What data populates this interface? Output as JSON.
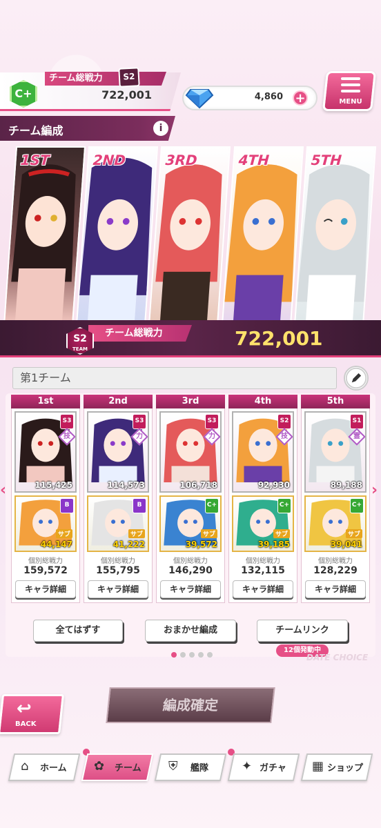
{
  "header": {
    "team_power_label": "チーム総戦力",
    "team_rank_badge": "S2",
    "player_rank": "C+",
    "team_power_value": "722,001",
    "diamonds": "4,860",
    "menu_label": "MENU"
  },
  "section": {
    "title": "チーム編成",
    "info": "i"
  },
  "banner": {
    "places": [
      "1ST",
      "2ND",
      "3RD",
      "4TH",
      "5TH"
    ],
    "power_label": "チーム総戦力",
    "rank_badge": "S2",
    "rank_sub": "TEAM",
    "power_value": "722,001"
  },
  "team_name": "第1チーム",
  "slots": [
    {
      "head": "1st",
      "rank": "S3",
      "type": "技",
      "power": "115,425",
      "sub_rank": "B",
      "sub_tag": "サブ",
      "sub_power": "44,147",
      "indiv_label": "個別総戦力",
      "indiv": "159,572",
      "detail": "キャラ詳細"
    },
    {
      "head": "2nd",
      "rank": "S3",
      "type": "力",
      "power": "114,573",
      "sub_rank": "B",
      "sub_tag": "サブ",
      "sub_power": "41,222",
      "indiv_label": "個別総戦力",
      "indiv": "155,795",
      "detail": "キャラ詳細"
    },
    {
      "head": "3rd",
      "rank": "S3",
      "type": "力",
      "power": "106,718",
      "sub_rank": "C+",
      "sub_tag": "サブ",
      "sub_power": "39,572",
      "indiv_label": "個別総戦力",
      "indiv": "146,290",
      "detail": "キャラ詳細"
    },
    {
      "head": "4th",
      "rank": "S2",
      "type": "技",
      "power": "92,930",
      "sub_rank": "C+",
      "sub_tag": "サブ",
      "sub_power": "39,185",
      "indiv_label": "個別総戦力",
      "indiv": "132,115",
      "detail": "キャラ詳細"
    },
    {
      "head": "5th",
      "rank": "S1",
      "type": "霊",
      "power": "89,188",
      "sub_rank": "C+",
      "sub_tag": "サブ",
      "sub_power": "39,041",
      "indiv_label": "個別総戦力",
      "indiv": "128,229",
      "detail": "キャラ詳細"
    }
  ],
  "actions": {
    "unequip_all": "全てはずす",
    "auto": "おまかせ編成",
    "team_link": "チームリンク",
    "link_badge": "12個発動中",
    "watermark": "DATE CHOICE"
  },
  "back_label": "BACK",
  "confirm_label": "編成確定",
  "nav": {
    "home": "ホーム",
    "team": "チーム",
    "fleet": "艦隊",
    "gacha": "ガチャ",
    "shop": "ショップ"
  },
  "colors": {
    "accent": "#e64f86",
    "dark": "#5a2448",
    "gold": "#ffe26b"
  }
}
